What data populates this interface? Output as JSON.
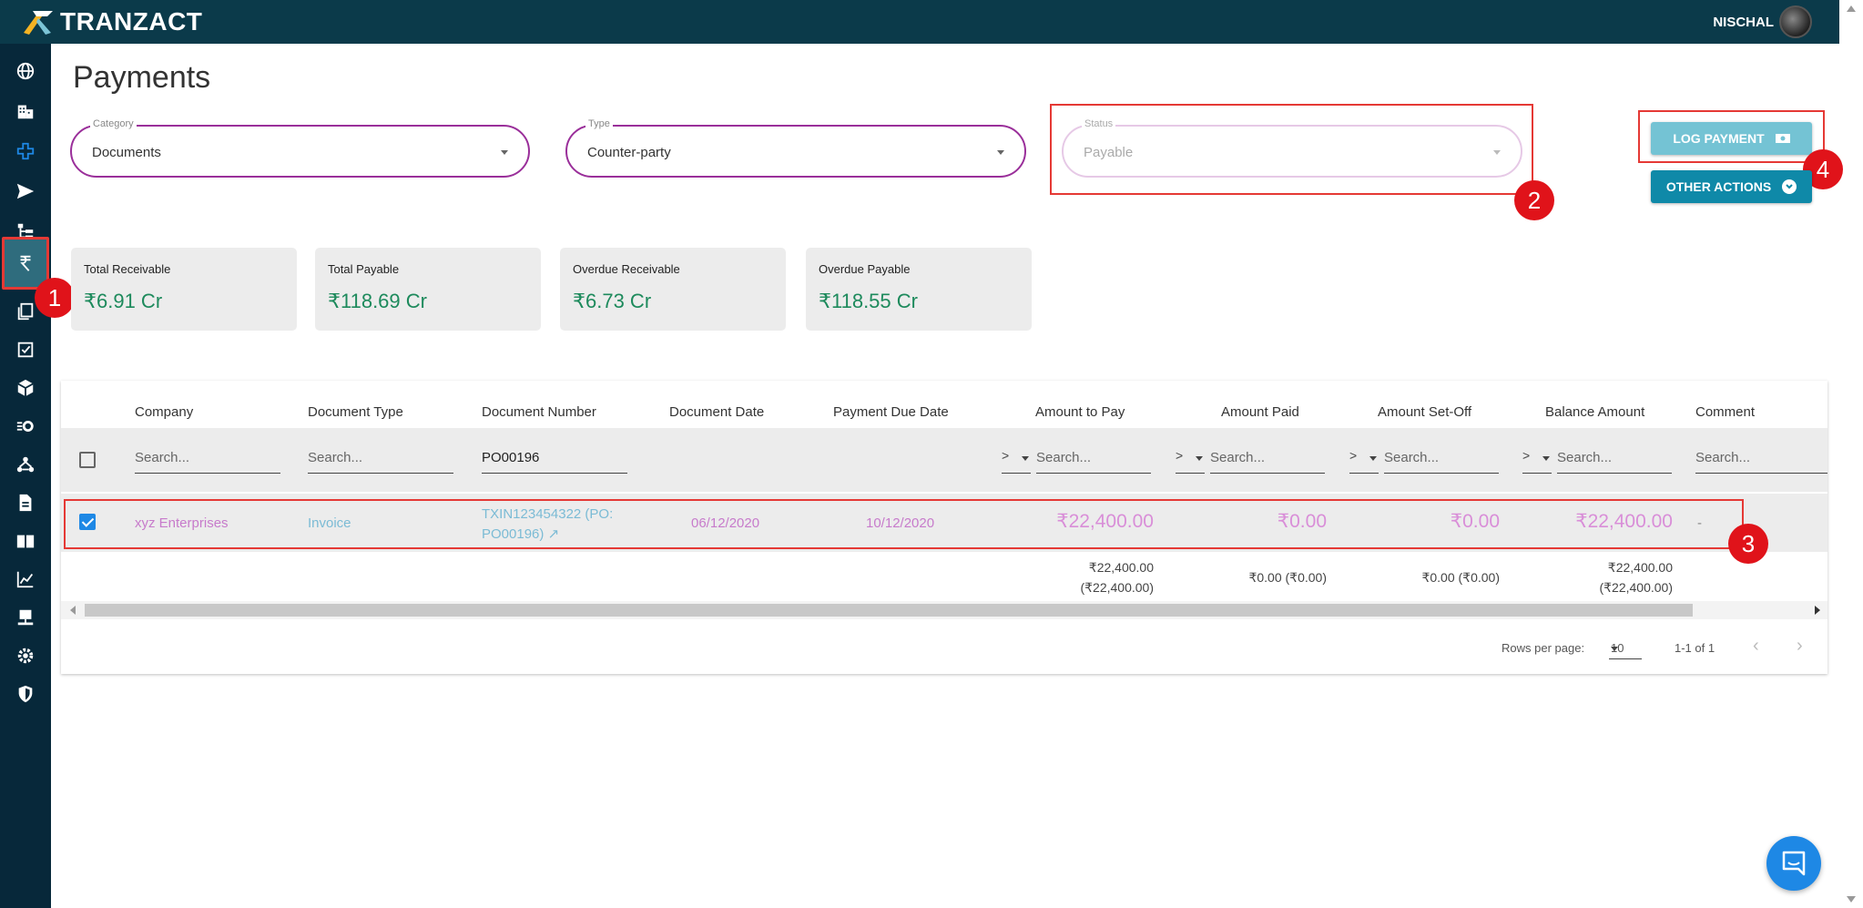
{
  "app": {
    "brand": "TRANZACT",
    "user": "NISCHAL"
  },
  "sidebar": {
    "items": [
      {
        "icon": "globe-icon"
      },
      {
        "icon": "building-icon"
      },
      {
        "icon": "plus-cross-icon"
      },
      {
        "icon": "send-icon"
      },
      {
        "icon": "hierarchy-icon"
      },
      {
        "icon": "rupee-icon",
        "active": true
      },
      {
        "icon": "documents-icon"
      },
      {
        "icon": "checklist-icon"
      },
      {
        "icon": "cube-icon"
      },
      {
        "icon": "process-gear-icon"
      },
      {
        "icon": "network-icon"
      },
      {
        "icon": "file-icon"
      },
      {
        "icon": "book-icon"
      },
      {
        "icon": "chart-icon"
      },
      {
        "icon": "server-icon"
      },
      {
        "icon": "settings-icon"
      },
      {
        "icon": "shield-icon"
      }
    ]
  },
  "page": {
    "title": "Payments"
  },
  "filters": {
    "category": {
      "label": "Category",
      "value": "Documents"
    },
    "type": {
      "label": "Type",
      "value": "Counter-party"
    },
    "status": {
      "label": "Status",
      "value": "Payable"
    }
  },
  "actions": {
    "log_payment": "LOG PAYMENT",
    "other_actions": "OTHER ACTIONS"
  },
  "cards": [
    {
      "label": "Total Receivable",
      "value": "₹6.91 Cr"
    },
    {
      "label": "Total Payable",
      "value": "₹118.69 Cr"
    },
    {
      "label": "Overdue Receivable",
      "value": "₹6.73 Cr"
    },
    {
      "label": "Overdue Payable",
      "value": "₹118.55 Cr"
    }
  ],
  "table": {
    "columns": [
      "Company",
      "Document Type",
      "Document Number",
      "Document Date",
      "Payment Due Date",
      "Amount to Pay",
      "Amount Paid",
      "Amount Set-Off",
      "Balance Amount",
      "Comment"
    ],
    "search_placeholder": "Search...",
    "document_number_filter": "PO00196",
    "op_symbol": ">",
    "row": {
      "company": "xyz Enterprises",
      "document_type": "Invoice",
      "document_number_line1": "TXIN123454322 (PO:",
      "document_number_line2": "PO00196)",
      "document_date": "06/12/2020",
      "payment_due_date": "10/12/2020",
      "amount_to_pay": "₹22,400.00",
      "amount_paid": "₹0.00",
      "amount_set_off": "₹0.00",
      "balance_amount": "₹22,400.00",
      "comment": "-"
    },
    "totals": {
      "amount_to_pay_1": "₹22,400.00",
      "amount_to_pay_2": "(₹22,400.00)",
      "amount_paid": "₹0.00 (₹0.00)",
      "amount_set_off": "₹0.00 (₹0.00)",
      "balance_1": "₹22,400.00",
      "balance_2": "(₹22,400.00)"
    },
    "pagination": {
      "rows_label": "Rows per page:",
      "rows_value": "10",
      "range": "1-1 of 1"
    }
  },
  "annotations": [
    "1",
    "2",
    "3",
    "4"
  ],
  "colors": {
    "topbar": "#0b3a4a",
    "sidebar": "#07283a",
    "accent_field": "#9a2f9a",
    "money_green": "#1d8a5c",
    "highlight_red": "#e53935"
  }
}
